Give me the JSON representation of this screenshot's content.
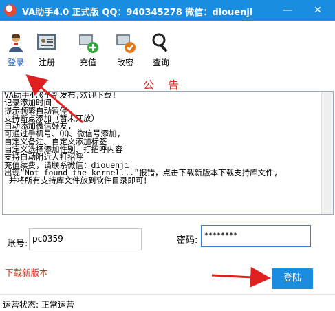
{
  "window": {
    "title": "VA助手4.0 正式版 QQ：940345278 微信：diouenji",
    "minimize_glyph": "—",
    "close_glyph": "✕"
  },
  "toolbar": {
    "items": [
      {
        "label": "登录",
        "icon": "login-icon"
      },
      {
        "label": "注册",
        "icon": "register-icon"
      },
      {
        "label": "充值",
        "icon": "recharge-icon"
      },
      {
        "label": "改密",
        "icon": "change-password-icon"
      },
      {
        "label": "查询",
        "icon": "query-icon"
      }
    ]
  },
  "notice": {
    "title": "公告",
    "lines": [
      "VA助手4.0全新发布,欢迎下载!",
      "记录添加时间",
      "提示频繁自动暂停",
      "支持断点添加（暂未开放）",
      "自动添加微信好友,",
      "可通过手机号、QQ、微信号添加,",
      "自定义备注、自定义添加标签",
      "自定义选择添加性别、打招呼内容",
      "支持自动附近人打招呼",
      "充值续费，请联系微信：diouenji",
      "出现“Not found the kernel...”报错，点击下载新版本下载支持库文件,",
      " 并将所有支持库文件放到软件目录即可！"
    ]
  },
  "login": {
    "account_label": "账号:",
    "account_value": "pc0359",
    "password_label": "密码:",
    "password_value": "********",
    "download_link": "下载新版本",
    "login_button": "登陆"
  },
  "status": {
    "text": "运营状态: 正常运营"
  },
  "colors": {
    "titlebar": "#1a8de0",
    "accent_red": "#e03020",
    "login_button": "#1a8de0"
  }
}
